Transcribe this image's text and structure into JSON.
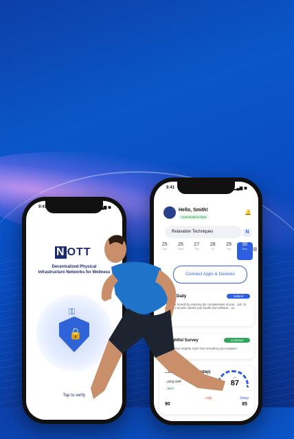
{
  "left_phone": {
    "time": "9:41",
    "logo": {
      "mark": "N",
      "rest": "OTT"
    },
    "tagline_line1": "Decentralized Physical",
    "tagline_line2": "Infrastructure Networks for Wellness",
    "tap_label": "Tap to verify"
  },
  "right_phone": {
    "time": "9:41",
    "greeting": "Hello, Smith!",
    "connected": "Connected to Bolt",
    "relax": "Relaxation Techniques",
    "n_badge": "N",
    "days": [
      {
        "n": "25",
        "d": "Tue"
      },
      {
        "n": "26",
        "d": "Wed"
      },
      {
        "n": "27",
        "d": "Thu"
      },
      {
        "n": "28",
        "d": "Fri"
      },
      {
        "n": "29",
        "d": "Sat"
      },
      {
        "n": "30",
        "d": "Sun",
        "on": true
      }
    ],
    "connect_button": "Connect Apps & Devices",
    "card1": {
      "title": "...age Daily",
      "desc": "...a extra Ncredit by ensuring the completeness of your ...ital. To boost +1 Ncredit, submit your health and wellness ...ta.",
      "button": "Submit"
    },
    "card2": {
      "title": "Insightful Survey",
      "desc": "Unlock Your Insights, Earn Your Ncredit by your answers.",
      "button": "Continue"
    },
    "card3": {
      "title": "...rall Score (Yesterday)",
      "sub": "...ping well",
      "sub2": "...Best",
      "gauge_small": "13",
      "gauge_value": "87",
      "readiness_label": "...",
      "readiness_value": "90",
      "body_label": "...ody",
      "sleep_label": "Sleep",
      "sleep_value": "85"
    }
  }
}
